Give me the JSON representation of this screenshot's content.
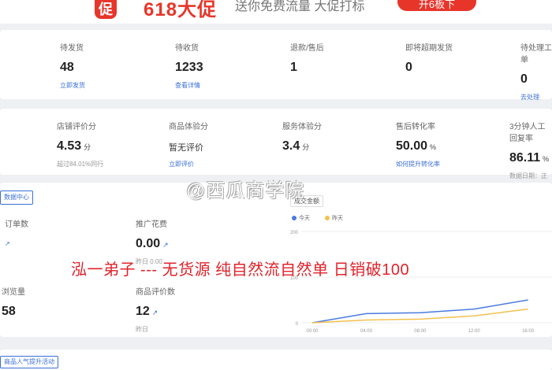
{
  "banner": {
    "badge": "促",
    "promo": "618大促",
    "tagline": "送你免费流量 大促打标",
    "cta": "开6板下"
  },
  "row1": [
    {
      "label": "待发货",
      "value": "48",
      "link": "立即发货"
    },
    {
      "label": "待收货",
      "value": "1233",
      "link": "查看详情"
    },
    {
      "label": "退款/售后",
      "value": "1",
      "link": ""
    },
    {
      "label": "即将超期发货",
      "value": "0",
      "link": ""
    },
    {
      "label": "待处理工单",
      "value": "0",
      "link": "去处理"
    }
  ],
  "row2": [
    {
      "label": "店铺评价分",
      "value": "4.53",
      "unit": "分",
      "sub": "超过84.01%同行"
    },
    {
      "label": "商品体验分",
      "value": "",
      "unit": "",
      "plain": "暂无评价",
      "sub": "",
      "link": "立即评价"
    },
    {
      "label": "服务体验分",
      "value": "3.4",
      "unit": "分",
      "sub": ""
    },
    {
      "label": "售后转化率",
      "value": "50.00",
      "unit": "%",
      "link": "如何提升转化率"
    },
    {
      "label": "3分钟人工回复率",
      "value": "86.11",
      "unit": "%",
      "sub": "数据日期：正"
    }
  ],
  "section3": {
    "chip": "数据中心",
    "metrics": [
      {
        "label": "订单数",
        "value": "",
        "sub": ""
      },
      {
        "label": "推广花费",
        "value": "0.00",
        "sub": "昨日 0.00"
      },
      {
        "label": "浏览量",
        "value": "58",
        "sub": ""
      },
      {
        "label": "商品评价数",
        "value": "12",
        "sub": "昨日"
      }
    ],
    "chart": {
      "title": "成交金额",
      "legend": [
        {
          "name": "今天",
          "color": "#4a7be0"
        },
        {
          "name": "昨天",
          "color": "#f2c14e"
        }
      ]
    }
  },
  "chart_data": {
    "type": "line",
    "title": "成交金额",
    "x": [
      "00:00",
      "04:00",
      "08:00",
      "12:00",
      "16:00"
    ],
    "y_ticks": [
      "0",
      "100",
      "200"
    ],
    "ylim": [
      0,
      200
    ],
    "series": [
      {
        "name": "今天",
        "values": [
          0,
          20,
          22,
          30,
          50
        ]
      },
      {
        "name": "昨天",
        "values": [
          0,
          6,
          8,
          15,
          30
        ]
      }
    ],
    "grid": true,
    "legend_position": "top-left"
  },
  "bottom": {
    "chip": "商品人气提升活动"
  },
  "watermark": "@西瓜商学院",
  "overlay_text": "泓一弟子 --- 无货源 纯自然流自然单 日销破100"
}
